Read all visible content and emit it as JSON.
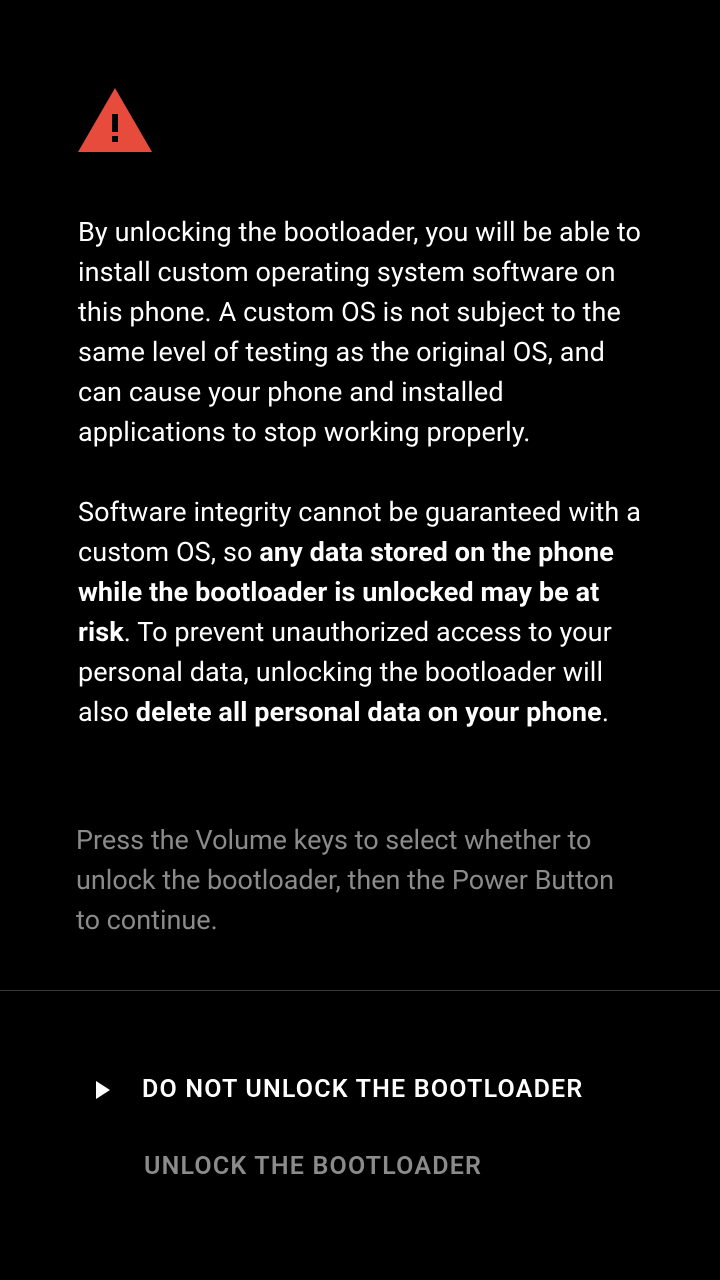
{
  "warning": {
    "icon": "warning-triangle-icon",
    "paragraph1": "By unlocking the bootloader, you will be able to install custom operating system software on this phone. A custom OS is not subject to the same level of testing as the original OS, and can cause your phone and installed applications to stop working properly.",
    "paragraph2_pre": "Software integrity cannot be guaranteed with a custom OS, so ",
    "paragraph2_bold1": "any data stored on the phone while the bootloader is unlocked may be at risk",
    "paragraph2_mid": ". To prevent unauthorized access to your personal data, unlocking the bootloader will also ",
    "paragraph2_bold2": "delete all personal data on your phone",
    "paragraph2_end": "."
  },
  "instructions": "Press the Volume keys to select whether to unlock the bootloader, then the Power Button to continue.",
  "options": {
    "do_not_unlock": "DO NOT UNLOCK THE BOOTLOADER",
    "unlock": "UNLOCK THE BOOTLOADER"
  }
}
